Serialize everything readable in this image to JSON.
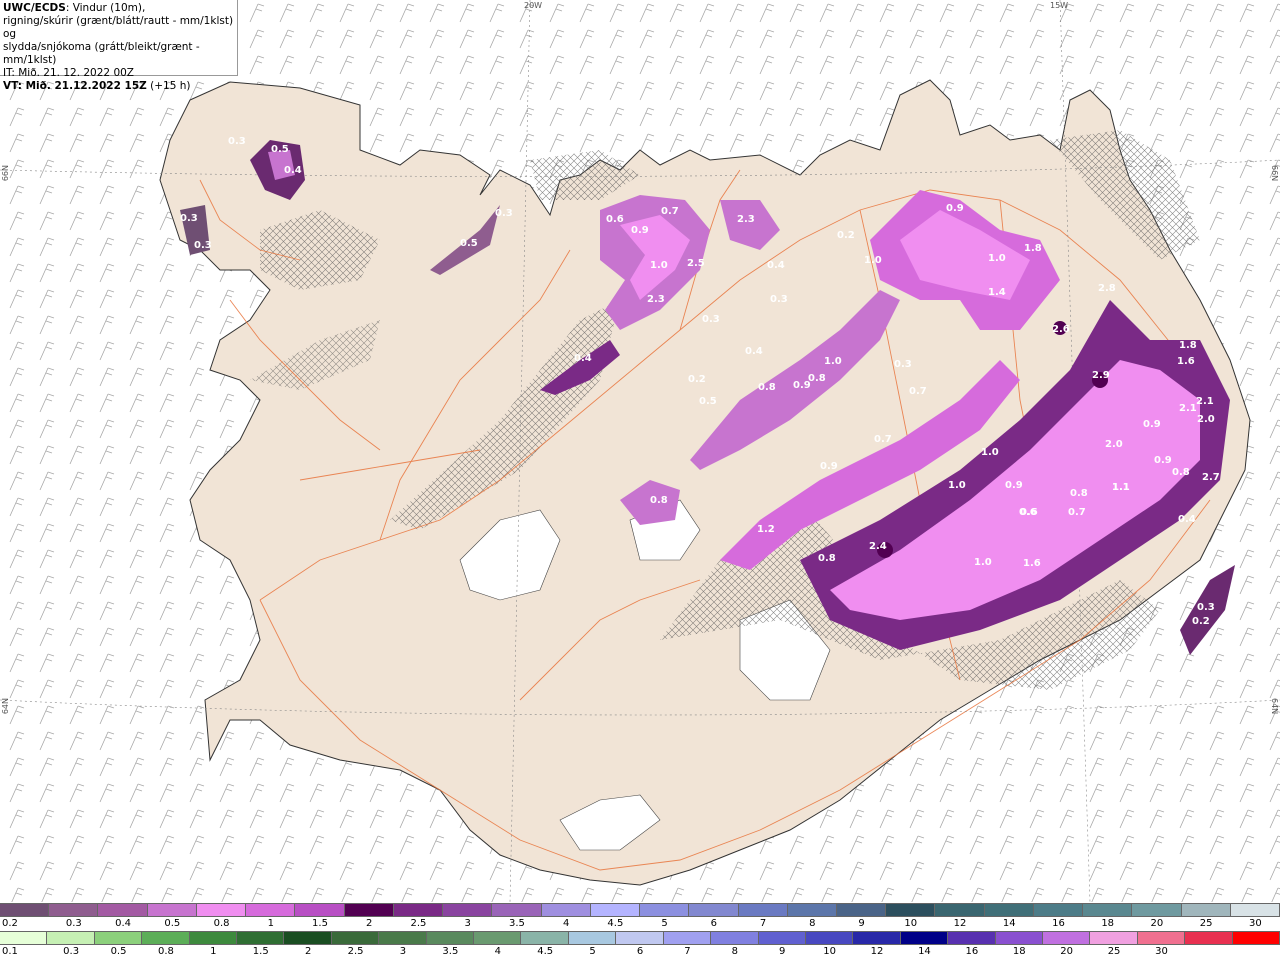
{
  "header": {
    "line1_bold": "UWC/ECDS",
    "line1_rest": ": Vindur (10m),",
    "line2": "rigning/skúrir (grænt/blátt/rautt - mm/1klst) og",
    "line3": "slydda/snjókoma (grátt/bleikt/grænt - mm/1klst)",
    "line4": "IT: Mið. 21. 12. 2022 00Z",
    "line5_bold": "VT: Mið. 21.12.2022 15Z",
    "line5_rest": " (+15 h)"
  },
  "coord_labels": {
    "w20": "20W",
    "w15": "15W",
    "n66_left": "66N",
    "n66_right": "66N",
    "n64_left": "64N",
    "n64_right": "64N"
  },
  "colors": {
    "land": "#f1e4d6",
    "sea": "#ffffff",
    "roads": "#e8743c",
    "snow_light": "#d060e8",
    "snow_dark": "#6a2a70",
    "snow_mid": "#e98bf0"
  },
  "legend_top": {
    "colors": [
      "#6f4f73",
      "#8f5d8f",
      "#a35aa3",
      "#c774cf",
      "#f08ef0",
      "#d66bdc",
      "#b84fc4",
      "#520052",
      "#7a2a86",
      "#8a44a0",
      "#9a64b8",
      "#9f8fe0",
      "#b4b4ff",
      "#8c90e0",
      "#8288d0",
      "#6a7ac2",
      "#5c76aa",
      "#4a6488",
      "#2c4f5e",
      "#3a6670",
      "#406f78",
      "#4d7c88",
      "#5a8890",
      "#6f9aa0",
      "#a0b6bc",
      "#d8e2e6"
    ],
    "labels": [
      "0.2",
      "0.3",
      "0.4",
      "0.5",
      "0.8",
      "1",
      "1.5",
      "2",
      "2.5",
      "3",
      "3.5",
      "4",
      "4.5",
      "5",
      "6",
      "7",
      "8",
      "9",
      "10",
      "12",
      "14",
      "16",
      "18",
      "20",
      "25",
      "30"
    ]
  },
  "legend_bottom": {
    "colors": [
      "#e6ffd8",
      "#c6f0b4",
      "#8cd07c",
      "#5cae58",
      "#3d8a3d",
      "#2f6e33",
      "#1a4e22",
      "#3a6a3a",
      "#4a7a4a",
      "#5a8a5e",
      "#6a9a70",
      "#8ab4a8",
      "#a8c8e0",
      "#c0c8f0",
      "#a0a0f0",
      "#8080e0",
      "#6060d0",
      "#4848c0",
      "#2828a8",
      "#000088",
      "#5830b0",
      "#8a50d0",
      "#c070e0",
      "#f0a0e0",
      "#f07090",
      "#e83050",
      "#ff0000"
    ],
    "labels": [
      "0.1",
      "0.3",
      "0.5",
      "0.8",
      "1",
      "1.5",
      "2",
      "2.5",
      "3",
      "3.5",
      "4",
      "4.5",
      "5",
      "6",
      "7",
      "8",
      "9",
      "10",
      "12",
      "14",
      "16",
      "18",
      "20",
      "25",
      "30"
    ]
  },
  "precip_values": [
    {
      "id": "nw1",
      "text": "0.5"
    },
    {
      "id": "nw2",
      "text": "0.4"
    },
    {
      "id": "nw3",
      "text": "0.3"
    },
    {
      "id": "nw4",
      "text": "0.3"
    },
    {
      "id": "nw5",
      "text": "0.3"
    },
    {
      "id": "n1",
      "text": "0.5"
    },
    {
      "id": "n2",
      "text": "0.3"
    },
    {
      "id": "n3",
      "text": "0.6"
    },
    {
      "id": "n4",
      "text": "0.9"
    },
    {
      "id": "n5",
      "text": "0.7"
    },
    {
      "id": "n6",
      "text": "2.3"
    },
    {
      "id": "n7",
      "text": "1.0"
    },
    {
      "id": "n8",
      "text": "2.5"
    },
    {
      "id": "n9",
      "text": "2.3"
    },
    {
      "id": "n10",
      "text": "0.4"
    },
    {
      "id": "n11",
      "text": "0.3"
    },
    {
      "id": "n12",
      "text": "0.3"
    },
    {
      "id": "n13",
      "text": "0.4"
    },
    {
      "id": "n14",
      "text": "0.2"
    },
    {
      "id": "n15",
      "text": "0.5"
    },
    {
      "id": "c1",
      "text": "0.4"
    },
    {
      "id": "c2",
      "text": "0.8"
    },
    {
      "id": "c3",
      "text": "0.9"
    },
    {
      "id": "c4",
      "text": "0.8"
    },
    {
      "id": "c5",
      "text": "1.0"
    },
    {
      "id": "c6",
      "text": "0.3"
    },
    {
      "id": "c7",
      "text": "0.7"
    },
    {
      "id": "c8",
      "text": "0.7"
    },
    {
      "id": "c9",
      "text": "0.9"
    },
    {
      "id": "c10",
      "text": "0.8"
    },
    {
      "id": "c11",
      "text": "1.2"
    },
    {
      "id": "c12",
      "text": "0.2"
    },
    {
      "id": "e1",
      "text": "0.9"
    },
    {
      "id": "e2",
      "text": "1.0"
    },
    {
      "id": "e3",
      "text": "1.0"
    },
    {
      "id": "e4",
      "text": "1.8"
    },
    {
      "id": "e5",
      "text": "1.4"
    },
    {
      "id": "e6",
      "text": "2.8"
    },
    {
      "id": "e7",
      "text": "2.6"
    },
    {
      "id": "e8",
      "text": "2.9"
    },
    {
      "id": "e9",
      "text": "1.8"
    },
    {
      "id": "e10",
      "text": "1.6"
    },
    {
      "id": "e11",
      "text": "2.1"
    },
    {
      "id": "e12",
      "text": "2.1"
    },
    {
      "id": "e13",
      "text": "2.0"
    },
    {
      "id": "e14",
      "text": "0.9"
    },
    {
      "id": "e15",
      "text": "2.0"
    },
    {
      "id": "e16",
      "text": "0.9"
    },
    {
      "id": "e17",
      "text": "0.8"
    },
    {
      "id": "e18",
      "text": "1.1"
    },
    {
      "id": "e19",
      "text": "1.0"
    },
    {
      "id": "e20",
      "text": "1.0"
    },
    {
      "id": "e21",
      "text": "0.9"
    },
    {
      "id": "e22",
      "text": "0.8"
    },
    {
      "id": "e23",
      "text": "0.7"
    },
    {
      "id": "e24",
      "text": "0.6"
    },
    {
      "id": "e25",
      "text": "0.8"
    },
    {
      "id": "e26",
      "text": "2.4"
    },
    {
      "id": "e27",
      "text": "1.0"
    },
    {
      "id": "e28",
      "text": "1.6"
    },
    {
      "id": "e29",
      "text": "0.4"
    },
    {
      "id": "e30",
      "text": "0.3"
    },
    {
      "id": "e31",
      "text": "0.2"
    },
    {
      "id": "e32",
      "text": "2.7"
    },
    {
      "id": "e33",
      "text": "1.1"
    },
    {
      "id": "e34",
      "text": "0.6"
    }
  ]
}
